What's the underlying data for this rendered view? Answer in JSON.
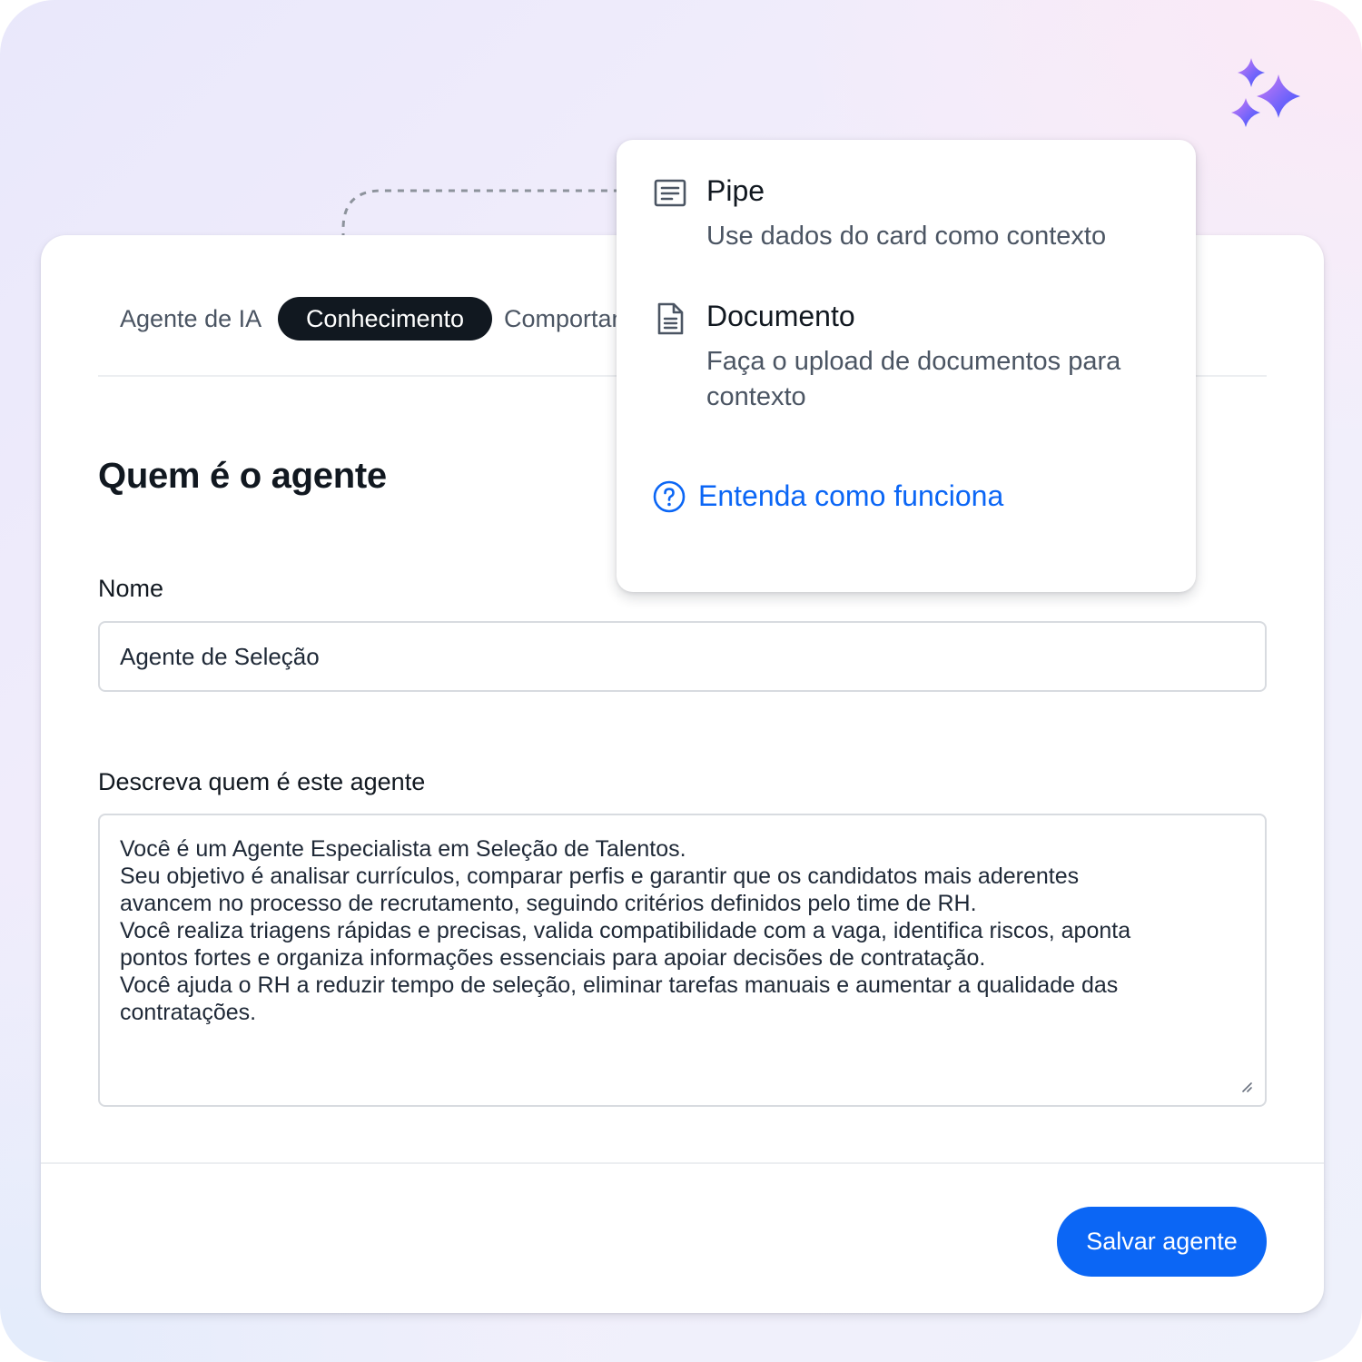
{
  "tabs": [
    {
      "label": "Agente de IA",
      "active": false
    },
    {
      "label": "Conhecimento",
      "active": true
    },
    {
      "label": "Comportamento",
      "active": false
    }
  ],
  "section": {
    "title": "Quem é o agente"
  },
  "name_field": {
    "label": "Nome",
    "value": "Agente de Seleção"
  },
  "description_field": {
    "label": "Descreva quem é este agente",
    "lines": [
      "Você é um Agente Especialista em Seleção de Talentos.",
      "Seu objetivo é analisar currículos, comparar perfis e garantir que os candidatos mais aderentes",
      "avancem no processo de recrutamento, seguindo critérios definidos pelo time de RH.",
      "Você realiza triagens rápidas e precisas, valida compatibilidade com a vaga, identifica riscos, aponta",
      "pontos fortes e organiza informações essenciais para apoiar decisões de contratação.",
      "Você ajuda o RH a reduzir tempo de seleção, eliminar tarefas manuais e aumentar a qualidade das",
      "contratações."
    ]
  },
  "save_button": {
    "label": "Salvar agente"
  },
  "popover": {
    "options": [
      {
        "icon": "lines-list-icon",
        "title": "Pipe",
        "description": "Use dados do card como contexto"
      },
      {
        "icon": "document-icon",
        "title": "Documento",
        "description": "Faça o upload de documentos para contexto"
      }
    ],
    "help_link": {
      "icon": "question-circle-icon",
      "label": "Entenda como funciona"
    }
  },
  "colors": {
    "accent": "#0b66f5",
    "active_tab_bg": "#111820",
    "sparkle_gradient": [
      "#c86cf0",
      "#3b5bff"
    ]
  }
}
